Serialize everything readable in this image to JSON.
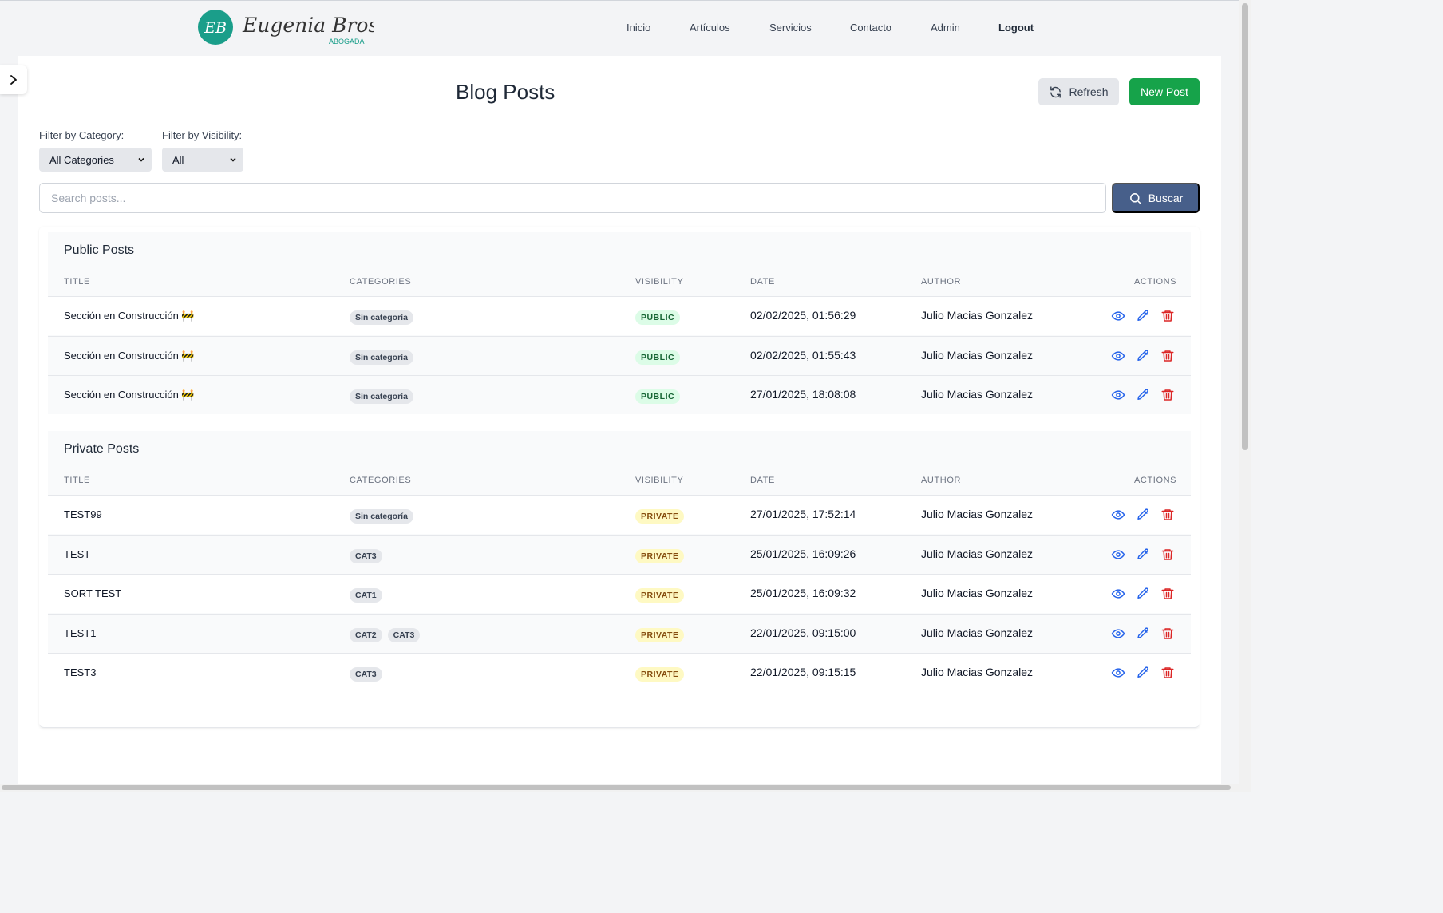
{
  "brand": {
    "monogram": "EB",
    "name": "Eugenia Bros",
    "tagline": "ABOGADA",
    "color": "#1a9e8a"
  },
  "nav": {
    "items": [
      {
        "label": "Inicio"
      },
      {
        "label": "Artículos"
      },
      {
        "label": "Servicios"
      },
      {
        "label": "Contacto"
      },
      {
        "label": "Admin"
      },
      {
        "label": "Logout"
      }
    ]
  },
  "page": {
    "title": "Blog Posts",
    "refresh_label": "Refresh",
    "new_post_label": "New Post"
  },
  "filters": {
    "category_label": "Filter by Category:",
    "category_value": "All Categories",
    "visibility_label": "Filter by Visibility:",
    "visibility_value": "All"
  },
  "search": {
    "placeholder": "Search posts...",
    "button_label": "Buscar"
  },
  "columns": {
    "title": "TITLE",
    "categories": "CATEGORIES",
    "visibility": "VISIBILITY",
    "date": "DATE",
    "author": "AUTHOR",
    "actions": "ACTIONS"
  },
  "public_section": {
    "title": "Public Posts",
    "rows": [
      {
        "title": "Sección en Construcción 🚧",
        "categories": [
          "Sin categoría"
        ],
        "visibility": "PUBLIC",
        "date": "02/02/2025, 01:56:29",
        "author": "Julio Macias Gonzalez"
      },
      {
        "title": "Sección en Construcción 🚧",
        "categories": [
          "Sin categoría"
        ],
        "visibility": "PUBLIC",
        "date": "02/02/2025, 01:55:43",
        "author": "Julio Macias Gonzalez"
      },
      {
        "title": "Sección en Construcción 🚧",
        "categories": [
          "Sin categoría"
        ],
        "visibility": "PUBLIC",
        "date": "27/01/2025, 18:08:08",
        "author": "Julio Macias Gonzalez"
      }
    ]
  },
  "private_section": {
    "title": "Private Posts",
    "rows": [
      {
        "title": "TEST99",
        "categories": [
          "Sin categoría"
        ],
        "visibility": "PRIVATE",
        "date": "27/01/2025, 17:52:14",
        "author": "Julio Macias Gonzalez"
      },
      {
        "title": "TEST",
        "categories": [
          "CAT3"
        ],
        "visibility": "PRIVATE",
        "date": "25/01/2025, 16:09:26",
        "author": "Julio Macias Gonzalez"
      },
      {
        "title": "SORT TEST",
        "categories": [
          "CAT1"
        ],
        "visibility": "PRIVATE",
        "date": "25/01/2025, 16:09:32",
        "author": "Julio Macias Gonzalez"
      },
      {
        "title": "TEST1",
        "categories": [
          "CAT2",
          "CAT3"
        ],
        "visibility": "PRIVATE",
        "date": "22/01/2025, 09:15:00",
        "author": "Julio Macias Gonzalez"
      },
      {
        "title": "TEST3",
        "categories": [
          "CAT3"
        ],
        "visibility": "PRIVATE",
        "date": "22/01/2025, 09:15:15",
        "author": "Julio Macias Gonzalez"
      }
    ]
  },
  "icons": {
    "sidebar_toggle": "chevron-right-icon",
    "refresh": "refresh-icon",
    "search": "search-icon",
    "view": "eye-icon",
    "edit": "pencil-icon",
    "delete": "trash-icon"
  },
  "colors": {
    "primary_green": "#16a34a",
    "search_blue": "#475f8a",
    "action_blue": "#2563eb",
    "action_red": "#dc2626"
  }
}
